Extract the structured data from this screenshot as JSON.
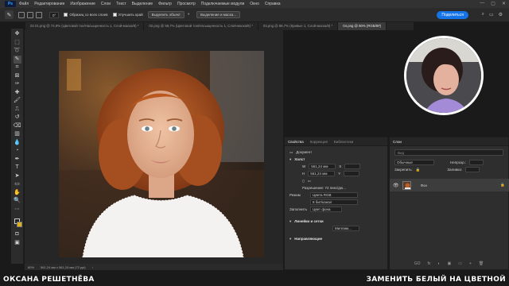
{
  "app": {
    "logo": "Ps"
  },
  "menu": [
    "Файл",
    "Редактирование",
    "Изображение",
    "Слои",
    "Текст",
    "Выделение",
    "Фильтр",
    "Просмотр",
    "Подключаемые модули",
    "Окно",
    "Справка"
  ],
  "options": {
    "angle": "0°",
    "sample_all": "Образец со всех слоев",
    "enhance_edge": "Улучшить край",
    "select_subject": "Выделить объект",
    "select_and_mask": "Выделение и маска..."
  },
  "share_label": "Поделиться",
  "tabs": [
    {
      "label": "02.01.png @ 74,9% (Цветовой тон/Насыщенность 1, Слой-маска/8) *",
      "active": false
    },
    {
      "label": "02.png @ 88,7% (Цветовой тон/Насыщенность 1, Слой-маска/8) *",
      "active": false
    },
    {
      "label": "03.png @ 88,7% (Кривые 1, Слой-маска/8) *",
      "active": false
    },
    {
      "label": "04.png @ 80% (RGB/8#)",
      "active": true
    }
  ],
  "status": {
    "zoom": "80%",
    "dims": "561,24 мм x 561,24 мм (72 ppi)"
  },
  "properties": {
    "tabs": [
      "Свойства",
      "Коррекция",
      "Библиотеки"
    ],
    "doc_label": "Документ",
    "canvas_section": "Холст",
    "w": "561,24 мм",
    "h": "561,24 мм",
    "x_label": "X",
    "y_label": "Y",
    "resolution": "Разрешение: 72 пикс/дю...",
    "mode_label": "Режим",
    "mode_value": "Цвета RGB",
    "depth_value": "8 бит/канал",
    "bg_label": "Заполнить",
    "bg_value": "Цвет фона",
    "rulers_section": "Линейки и сетки",
    "rulers_unit": "Миллим...",
    "guides_section": "Направляющие"
  },
  "layers": {
    "tabs": [
      "Слои"
    ],
    "search": "Вид",
    "mode": "Обычные",
    "opacity_label": "Непрозр.:",
    "lock_label": "Закрепить:",
    "fill_label": "Заливка:",
    "layer_name": "Фон",
    "footer": [
      "GO",
      "fx",
      "◐",
      "▣",
      "▭",
      "+",
      "🗑"
    ]
  },
  "captions": {
    "left": "ОКСАНА РЕШЕТНЁВА",
    "right": "ЗАМЕНИТЬ БЕЛЫЙ НА ЦВЕТНОЙ"
  }
}
